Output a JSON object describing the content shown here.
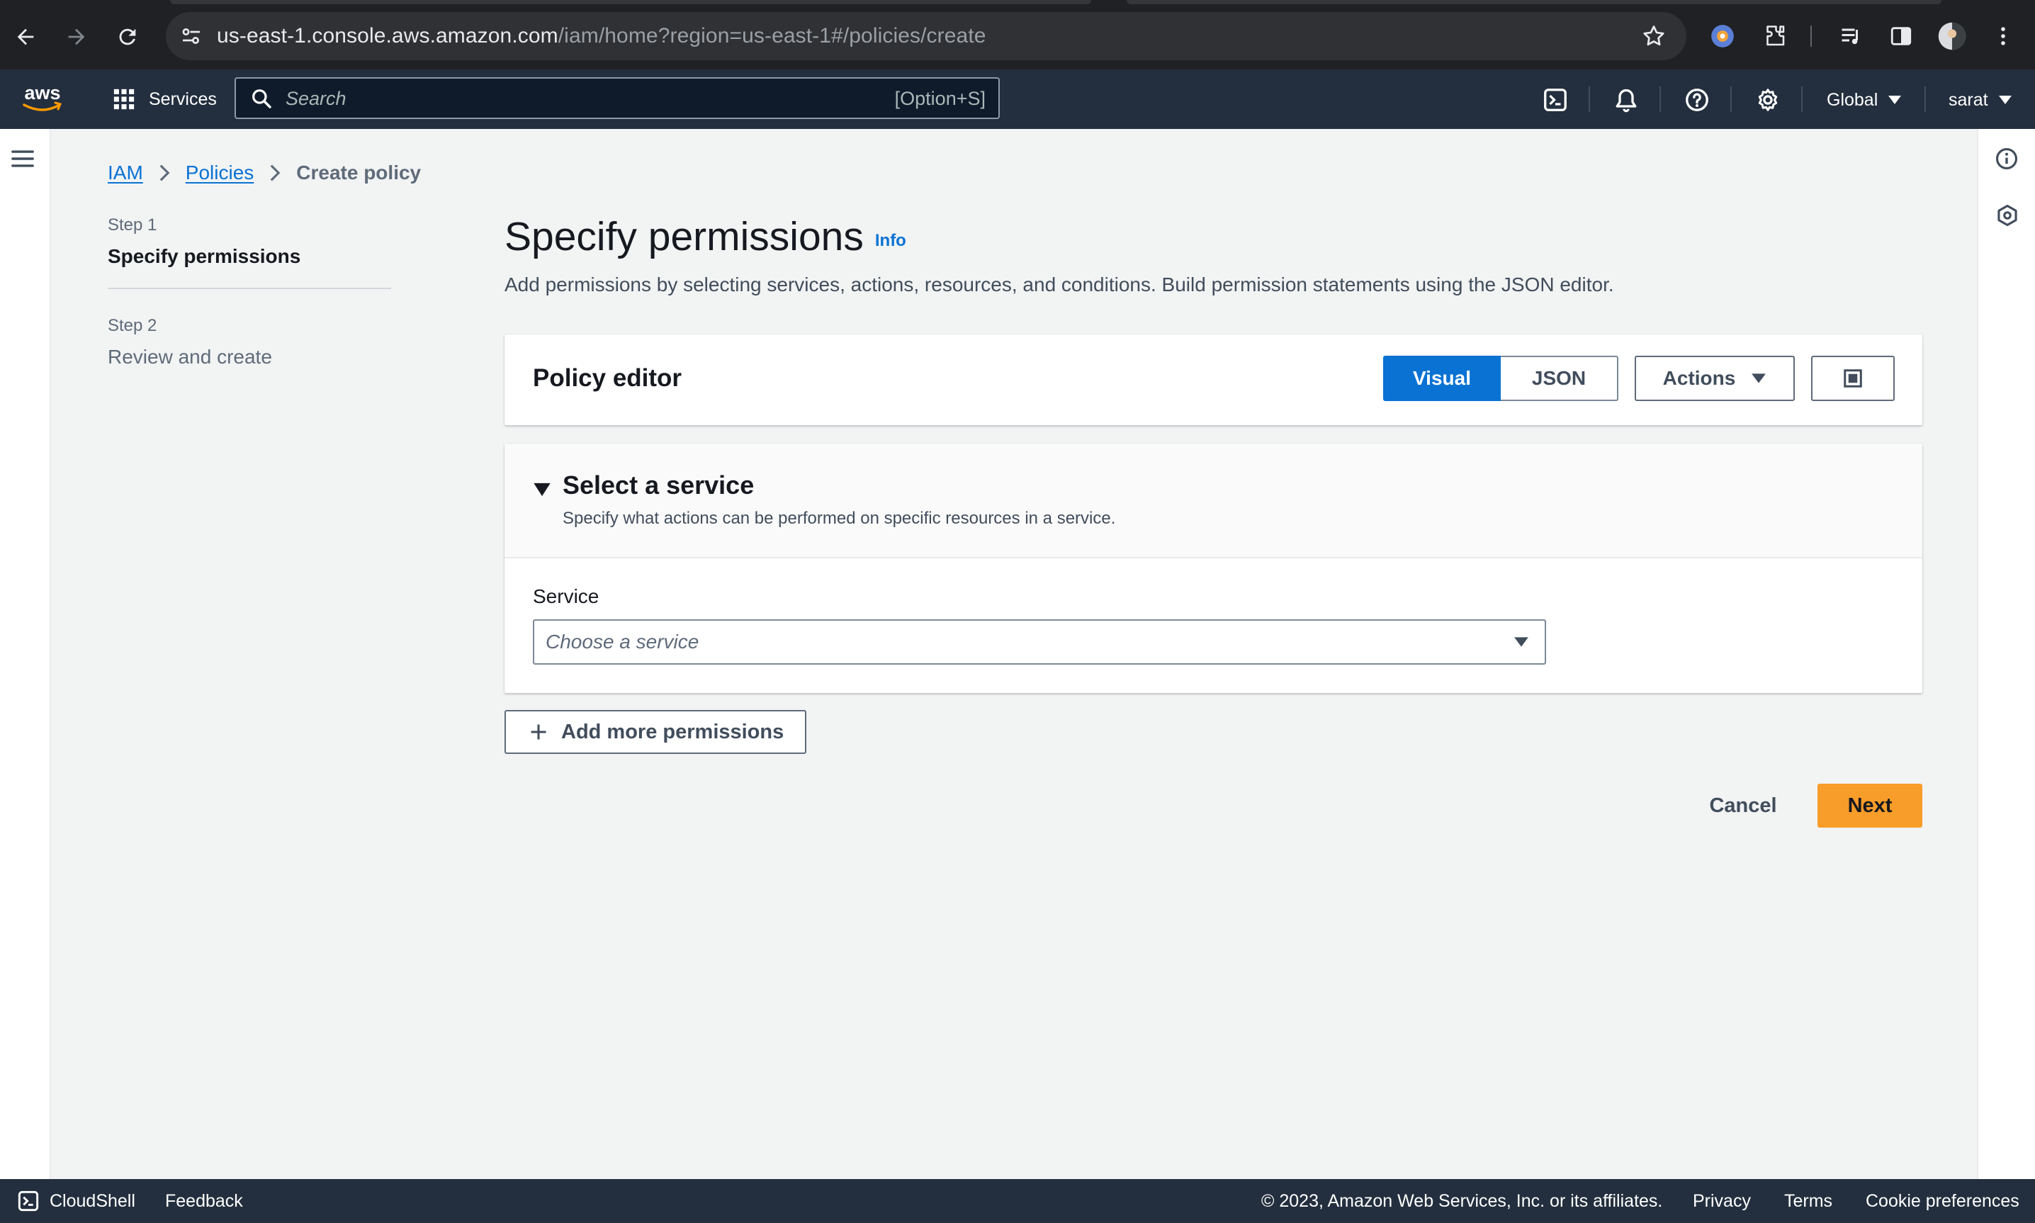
{
  "browser": {
    "url_host": "us-east-1.console.aws.amazon.com",
    "url_path": "/iam/home?region=us-east-1#/policies/create"
  },
  "topnav": {
    "services_label": "Services",
    "search_placeholder": "Search",
    "search_shortcut": "[Option+S]",
    "region_label": "Global",
    "user_label": "sarat"
  },
  "breadcrumb": {
    "items": [
      "IAM",
      "Policies"
    ],
    "current": "Create policy"
  },
  "steps": [
    {
      "number": "Step 1",
      "title": "Specify permissions",
      "active": true
    },
    {
      "number": "Step 2",
      "title": "Review and create",
      "active": false
    }
  ],
  "main": {
    "title": "Specify permissions",
    "info_link": "Info",
    "description": "Add permissions by selecting services, actions, resources, and conditions. Build permission statements using the JSON editor."
  },
  "policy_editor": {
    "title": "Policy editor",
    "modes": [
      "Visual",
      "JSON"
    ],
    "selected_mode": "Visual",
    "actions_label": "Actions"
  },
  "service_section": {
    "title": "Select a service",
    "description": "Specify what actions can be performed on specific resources in a service.",
    "field_label": "Service",
    "placeholder": "Choose a service"
  },
  "add_permissions_label": "Add more permissions",
  "cancel_label": "Cancel",
  "next_label": "Next",
  "footer": {
    "cloudshell": "CloudShell",
    "feedback": "Feedback",
    "copyright": "© 2023, Amazon Web Services, Inc. or its affiliates.",
    "privacy": "Privacy",
    "terms": "Terms",
    "cookies": "Cookie preferences"
  },
  "colors": {
    "aws_nav": "#232f3e",
    "primary_blue": "#0972d3",
    "next_orange": "#f89c2a",
    "page_bg": "#f2f3f3"
  }
}
